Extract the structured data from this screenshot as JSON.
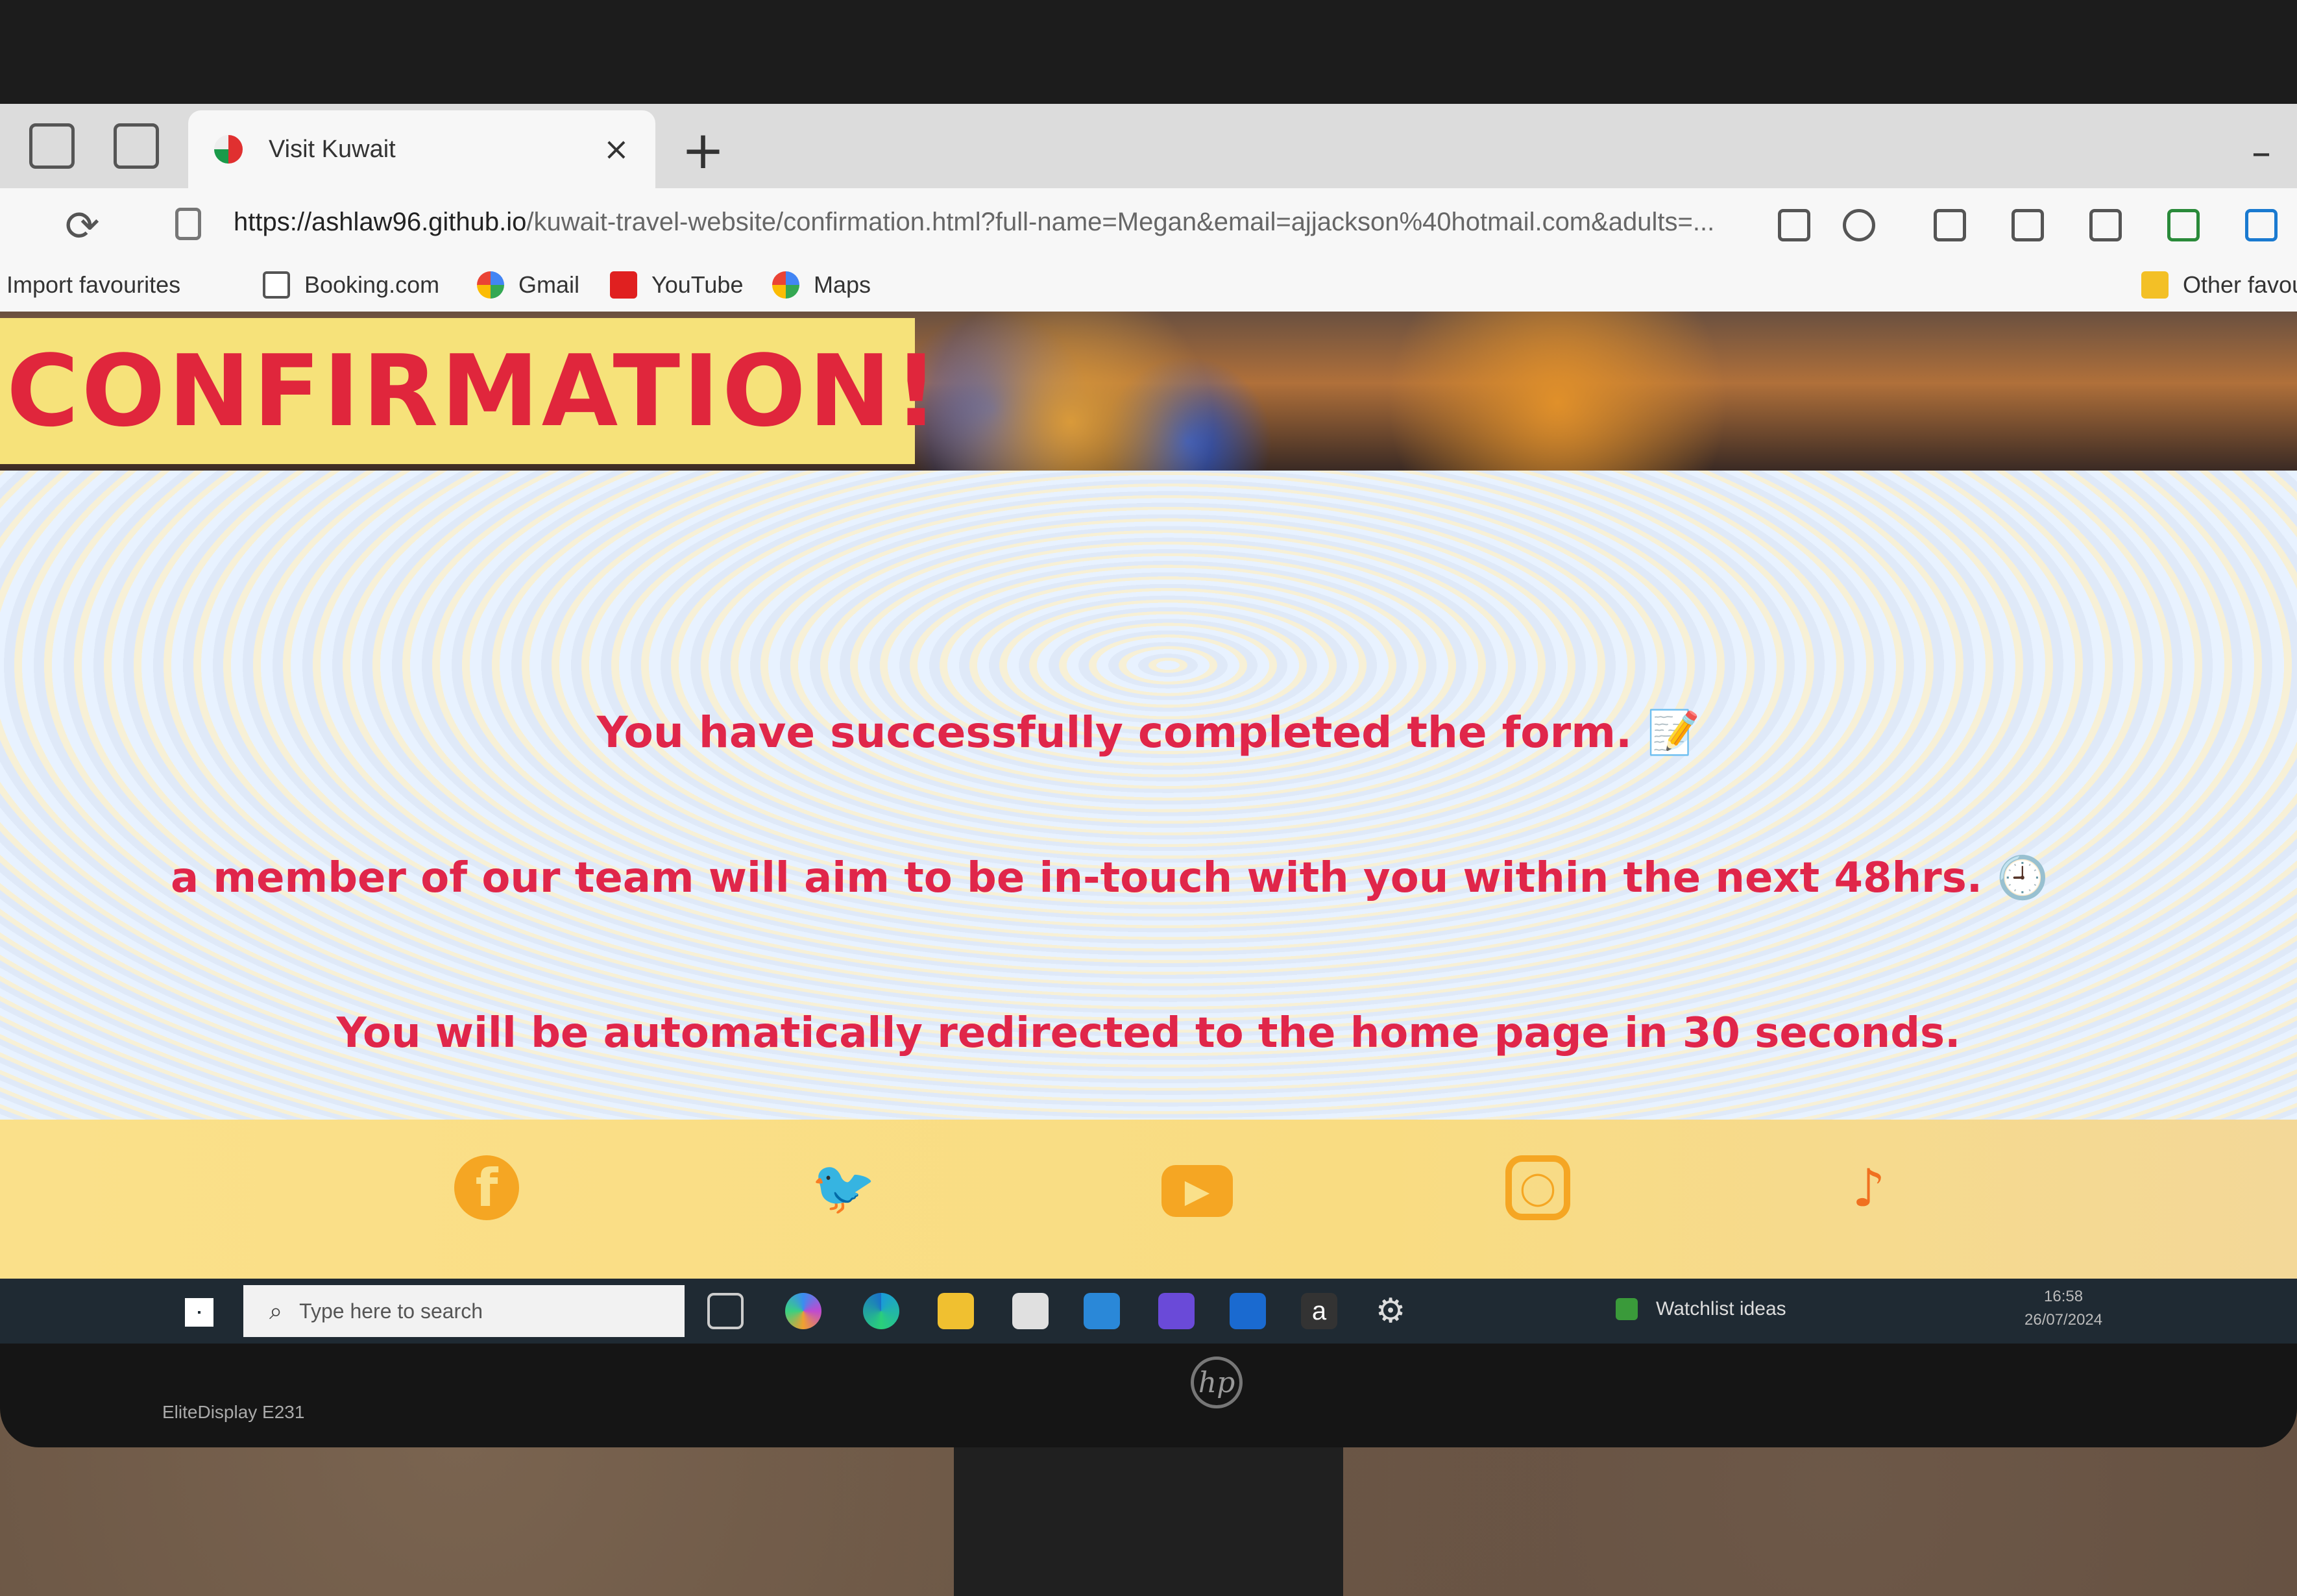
{
  "browser": {
    "tab_title": "Visit Kuwait",
    "tab_close": "×",
    "new_tab": "+",
    "minimize": "–",
    "url_host": "https://ashlaw96.github.io",
    "url_path": "/kuwait-travel-website/confirmation.html?full-name=Megan&email=ajjackson%40hotmail.com&adults=...",
    "favourites": [
      {
        "label": "Import favourites",
        "icon": "import-icon"
      },
      {
        "label": "Booking.com",
        "icon": "page-icon"
      },
      {
        "label": "Gmail",
        "icon": "google-icon"
      },
      {
        "label": "YouTube",
        "icon": "youtube-icon"
      },
      {
        "label": "Maps",
        "icon": "google-icon"
      }
    ],
    "other_favourites": "Other favour"
  },
  "page": {
    "hero_title": "CONFIRMATION!",
    "messages": [
      "You have successfully completed the form. 📝",
      "a member of our team will aim to be in-touch with you within the next 48hrs. 🕘",
      "You will be automatically redirected to the home page in 30 seconds."
    ],
    "social_icons": [
      "facebook-icon",
      "twitter-icon",
      "youtube-icon",
      "instagram-icon",
      "tiktok-icon"
    ]
  },
  "taskbar": {
    "search_placeholder": "Type here to search",
    "watchlist": "Watchlist ideas",
    "time": "16:58",
    "date": "26/07/2024"
  },
  "monitor": {
    "model": "EliteDisplay E231",
    "logo": "hp"
  },
  "colors": {
    "accent_red": "#e0264a",
    "hero_banner": "#f6e27a",
    "footer": "#fae08a",
    "social": "#f5a623"
  }
}
